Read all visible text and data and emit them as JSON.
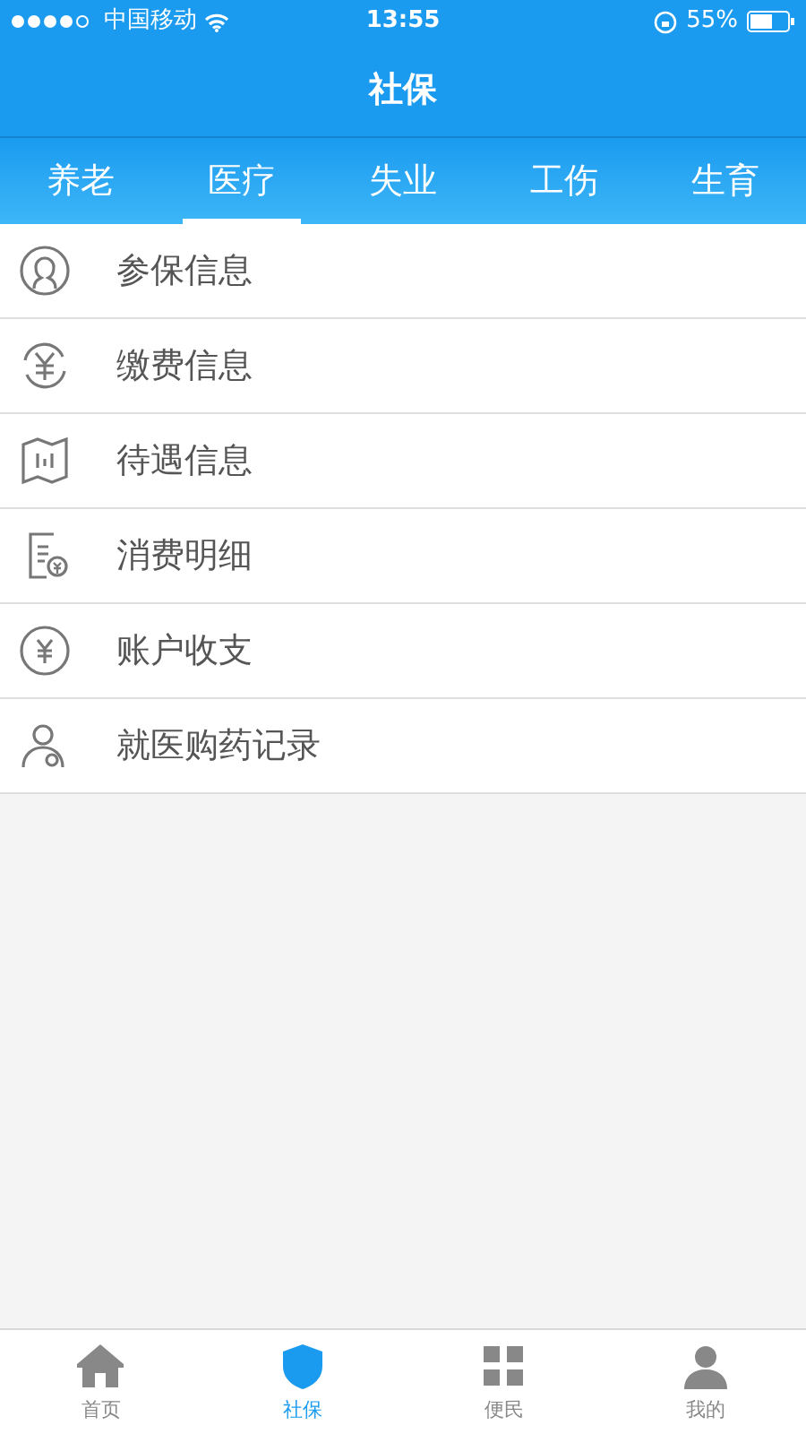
{
  "status_bar": {
    "carrier": "中国移动",
    "time": "13:55",
    "battery": "55%"
  },
  "nav": {
    "title": "社保"
  },
  "tabs": [
    {
      "label": "养老",
      "selected": false
    },
    {
      "label": "医疗",
      "selected": true
    },
    {
      "label": "失业",
      "selected": false
    },
    {
      "label": "工伤",
      "selected": false
    },
    {
      "label": "生育",
      "selected": false
    }
  ],
  "menu": [
    {
      "label": "参保信息"
    },
    {
      "label": "缴费信息"
    },
    {
      "label": "待遇信息"
    },
    {
      "label": "消费明细"
    },
    {
      "label": "账户收支"
    },
    {
      "label": "就医购药记录"
    }
  ],
  "tab_bar": [
    {
      "label": "首页",
      "selected": false
    },
    {
      "label": "社保",
      "selected": true
    },
    {
      "label": "便民",
      "selected": false
    },
    {
      "label": "我的",
      "selected": false
    }
  ]
}
